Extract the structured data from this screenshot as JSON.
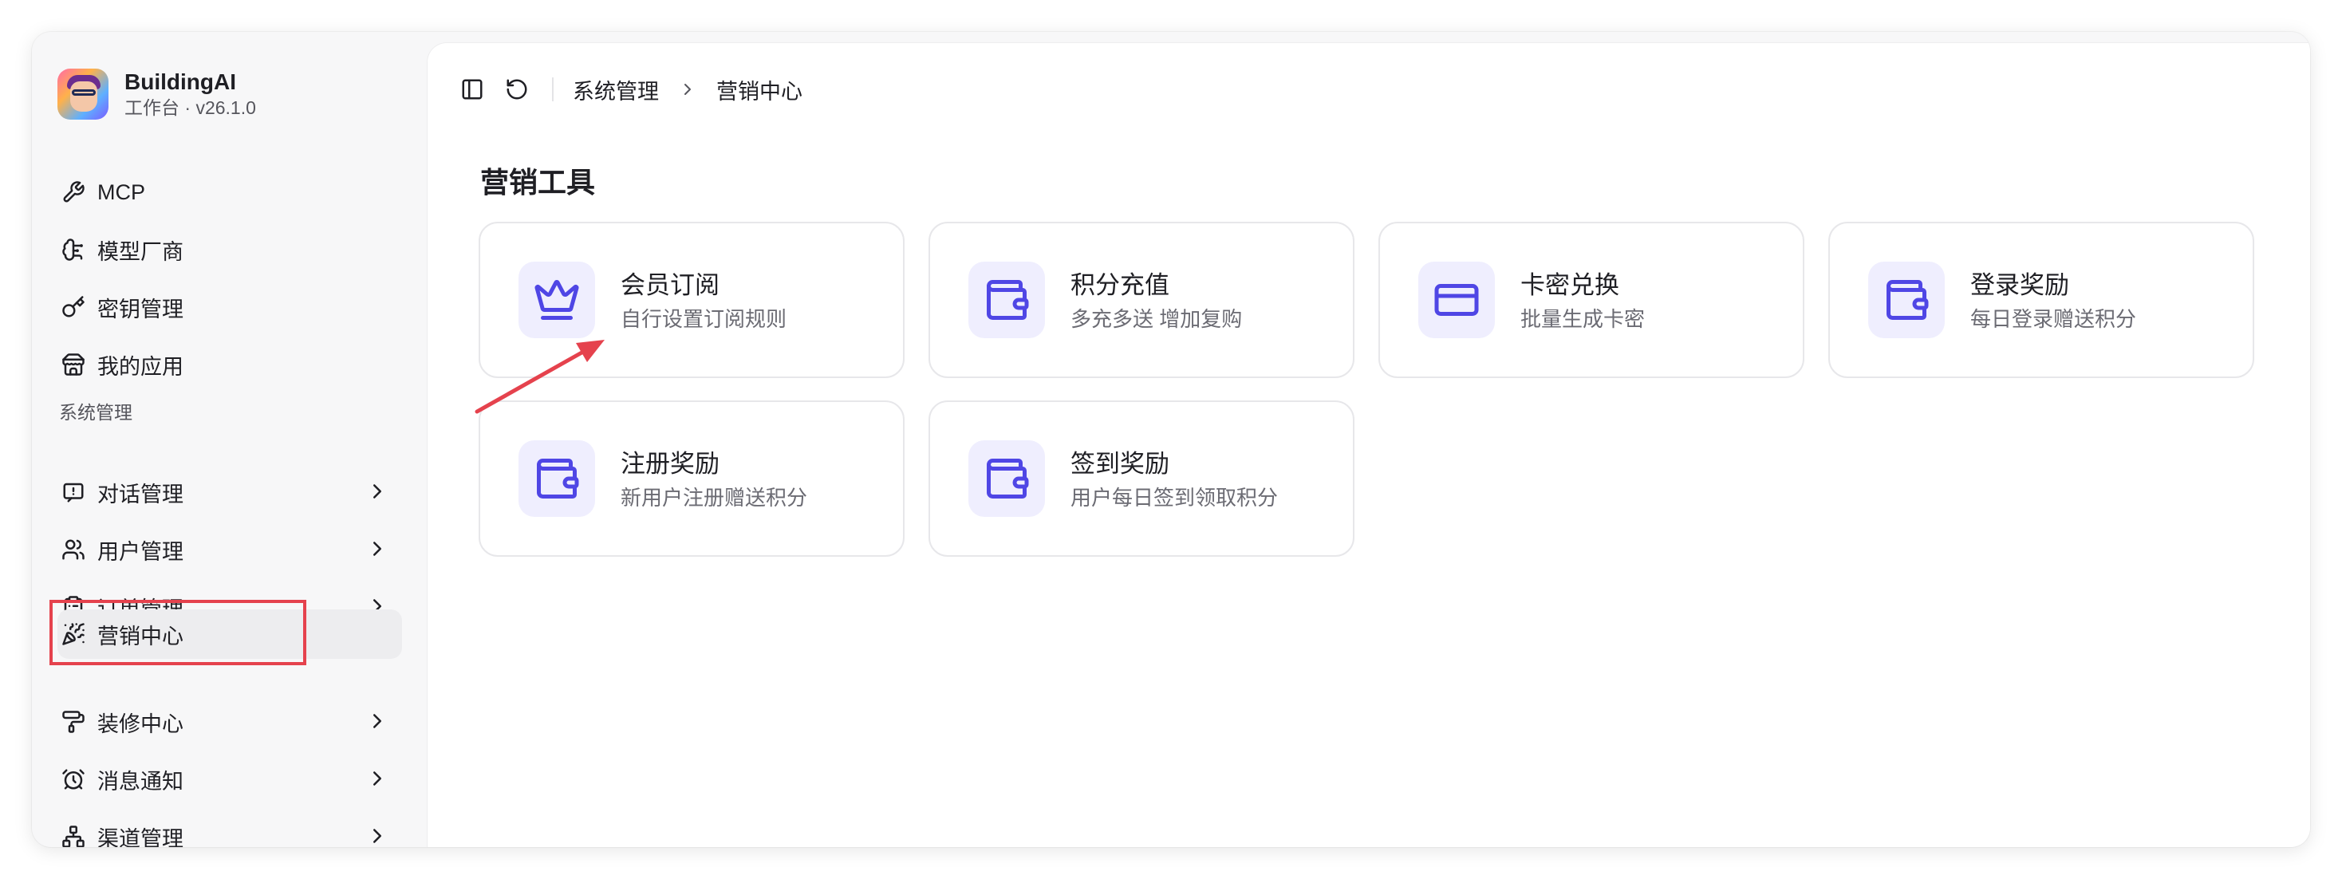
{
  "app": {
    "name": "BuildingAI",
    "subtitle": "工作台 · v26.1.0"
  },
  "sidebar": {
    "top_items": [
      {
        "label": "MCP",
        "icon": "wrench-icon"
      },
      {
        "label": "模型厂商",
        "icon": "brain-icon"
      },
      {
        "label": "密钥管理",
        "icon": "key-icon"
      },
      {
        "label": "我的应用",
        "icon": "store-icon"
      }
    ],
    "section_title": "系统管理",
    "section_items": [
      {
        "label": "对话管理",
        "icon": "message-square-icon",
        "has_children": true
      },
      {
        "label": "用户管理",
        "icon": "users-icon",
        "has_children": true
      },
      {
        "label": "订单管理",
        "icon": "clipboard-icon",
        "has_children": true
      },
      {
        "label": "营销中心",
        "icon": "party-popper-icon",
        "has_children": false,
        "active": true
      },
      {
        "label": "装修中心",
        "icon": "paint-roller-icon",
        "has_children": true
      },
      {
        "label": "消息通知",
        "icon": "alarm-clock-icon",
        "has_children": true
      },
      {
        "label": "渠道管理",
        "icon": "network-icon",
        "has_children": true
      }
    ]
  },
  "topbar": {
    "breadcrumb": [
      "系统管理",
      "营销中心"
    ]
  },
  "main": {
    "title": "营销工具",
    "cards": [
      {
        "title": "会员订阅",
        "desc": "自行设置订阅规则",
        "icon": "crown-icon"
      },
      {
        "title": "积分充值",
        "desc": "多充多送 增加复购",
        "icon": "wallet-icon"
      },
      {
        "title": "卡密兑换",
        "desc": "批量生成卡密",
        "icon": "credit-card-icon"
      },
      {
        "title": "登录奖励",
        "desc": "每日登录赠送积分",
        "icon": "wallet-icon"
      },
      {
        "title": "注册奖励",
        "desc": "新用户注册赠送积分",
        "icon": "wallet-icon"
      },
      {
        "title": "签到奖励",
        "desc": "用户每日签到领取积分",
        "icon": "wallet-icon"
      }
    ]
  },
  "colors": {
    "accent": "#4f46e5",
    "icon_bg": "#efeefe",
    "annotation_red": "#e5424d"
  }
}
